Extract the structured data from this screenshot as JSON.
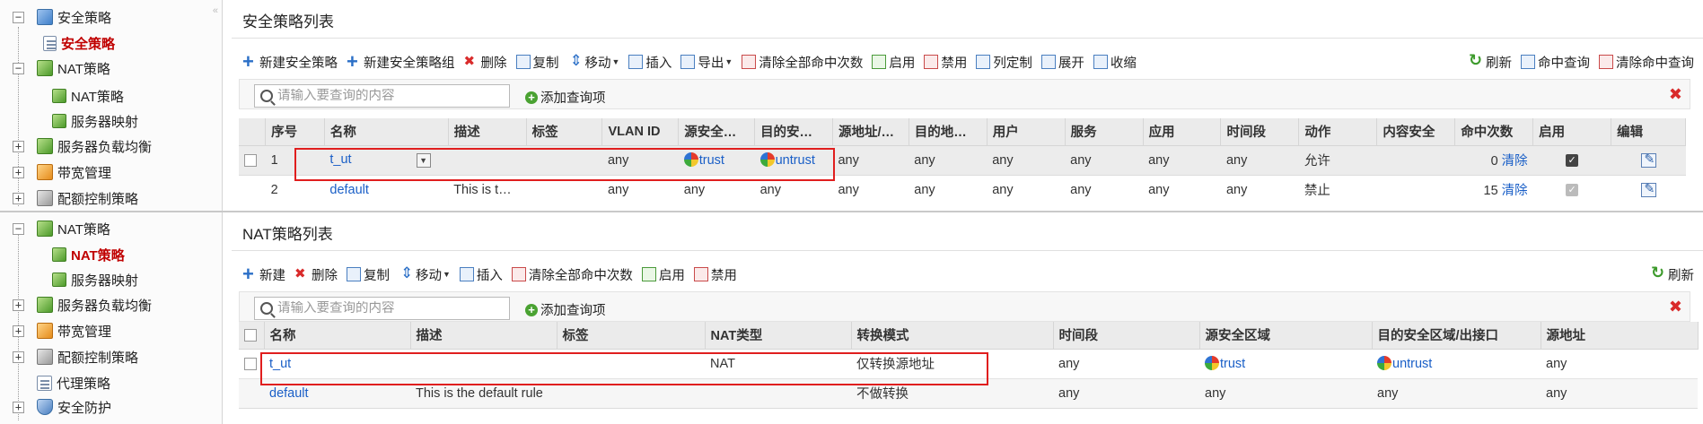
{
  "top": {
    "sidebar": {
      "items": [
        {
          "label": "安全策略",
          "icon": "security-policy-icon",
          "expander": "−"
        },
        {
          "label": "安全策略",
          "icon": "policy-doc-icon",
          "active": true
        },
        {
          "label": "NAT策略",
          "icon": "nat-icon",
          "expander": "−"
        },
        {
          "label": "NAT策略",
          "icon": "policy-doc-icon"
        },
        {
          "label": "服务器映射",
          "icon": "policy-doc-icon"
        },
        {
          "label": "服务器负载均衡",
          "icon": "load-balance-icon",
          "expander": "+"
        },
        {
          "label": "带宽管理",
          "icon": "bandwidth-icon",
          "expander": "+"
        },
        {
          "label": "配额控制策略",
          "icon": "quota-icon",
          "expander": "+"
        }
      ],
      "collapse_glyph": "«"
    },
    "panel_title": "安全策略列表",
    "toolbar": {
      "buttons": [
        "新建安全策略",
        "新建安全策略组",
        "删除",
        "复制",
        "移动",
        "插入",
        "导出",
        "清除全部命中次数",
        "启用",
        "禁用",
        "列定制",
        "展开",
        "收缩"
      ],
      "right_buttons": [
        "刷新",
        "命中查询",
        "清除命中查询"
      ]
    },
    "search": {
      "placeholder": "请输入要查询的内容",
      "add_query": "添加查询项",
      "close": "✖"
    },
    "table": {
      "headers": [
        "",
        "序号",
        "名称",
        "描述",
        "标签",
        "VLAN ID",
        "源安全…",
        "目的安…",
        "源地址/…",
        "目的地…",
        "用户",
        "服务",
        "应用",
        "时间段",
        "动作",
        "内容安全",
        "命中次数",
        "启用",
        "编辑"
      ],
      "rows": [
        {
          "seq": "1",
          "name": "t_ut",
          "desc": "",
          "tag": "",
          "vlan": "any",
          "src_zone": "trust",
          "dst_zone": "untrust",
          "src_addr": "any",
          "dst_addr": "any",
          "user": "any",
          "service": "any",
          "app": "any",
          "time": "any",
          "action": "允许",
          "content": "",
          "hits": "0",
          "clear": "清除",
          "enabled": true
        },
        {
          "seq": "2",
          "name": "default",
          "desc": "This is t…",
          "tag": "",
          "vlan": "any",
          "src_zone": "any",
          "dst_zone": "any",
          "src_addr": "any",
          "dst_addr": "any",
          "user": "any",
          "service": "any",
          "app": "any",
          "time": "any",
          "action": "禁止",
          "content": "",
          "hits": "15",
          "clear": "清除",
          "enabled": true
        }
      ]
    }
  },
  "bottom": {
    "sidebar": {
      "items": [
        {
          "label": "NAT策略",
          "icon": "nat-icon",
          "expander": "−"
        },
        {
          "label": "NAT策略",
          "icon": "policy-doc-icon",
          "active": true
        },
        {
          "label": "服务器映射",
          "icon": "policy-doc-icon"
        },
        {
          "label": "服务器负载均衡",
          "icon": "load-balance-icon",
          "expander": "+"
        },
        {
          "label": "带宽管理",
          "icon": "bandwidth-icon",
          "expander": "+"
        },
        {
          "label": "配额控制策略",
          "icon": "quota-icon",
          "expander": "+"
        },
        {
          "label": "代理策略",
          "icon": "proxy-icon"
        },
        {
          "label": "安全防护",
          "icon": "shield-icon",
          "expander": "+"
        }
      ]
    },
    "panel_title": "NAT策略列表",
    "toolbar": {
      "buttons": [
        "新建",
        "删除",
        "复制",
        "移动",
        "插入",
        "清除全部命中次数",
        "启用",
        "禁用"
      ],
      "right_buttons": [
        "刷新"
      ]
    },
    "search": {
      "placeholder": "请输入要查询的内容",
      "add_query": "添加查询项",
      "close": "✖"
    },
    "table": {
      "headers": [
        "",
        "名称",
        "描述",
        "标签",
        "NAT类型",
        "转换模式",
        "时间段",
        "源安全区域",
        "目的安全区域/出接口",
        "源地址"
      ],
      "rows": [
        {
          "name": "t_ut",
          "desc": "",
          "tag": "",
          "nat_type": "NAT",
          "mode": "仅转换源地址",
          "time": "any",
          "src_zone": "trust",
          "dst_zone": "untrust",
          "src_addr": "any"
        },
        {
          "name": "default",
          "desc": "This is the default rule",
          "tag": "",
          "nat_type": "",
          "mode": "不做转换",
          "time": "any",
          "src_zone": "any",
          "dst_zone": "any",
          "src_addr": "any"
        }
      ]
    }
  }
}
